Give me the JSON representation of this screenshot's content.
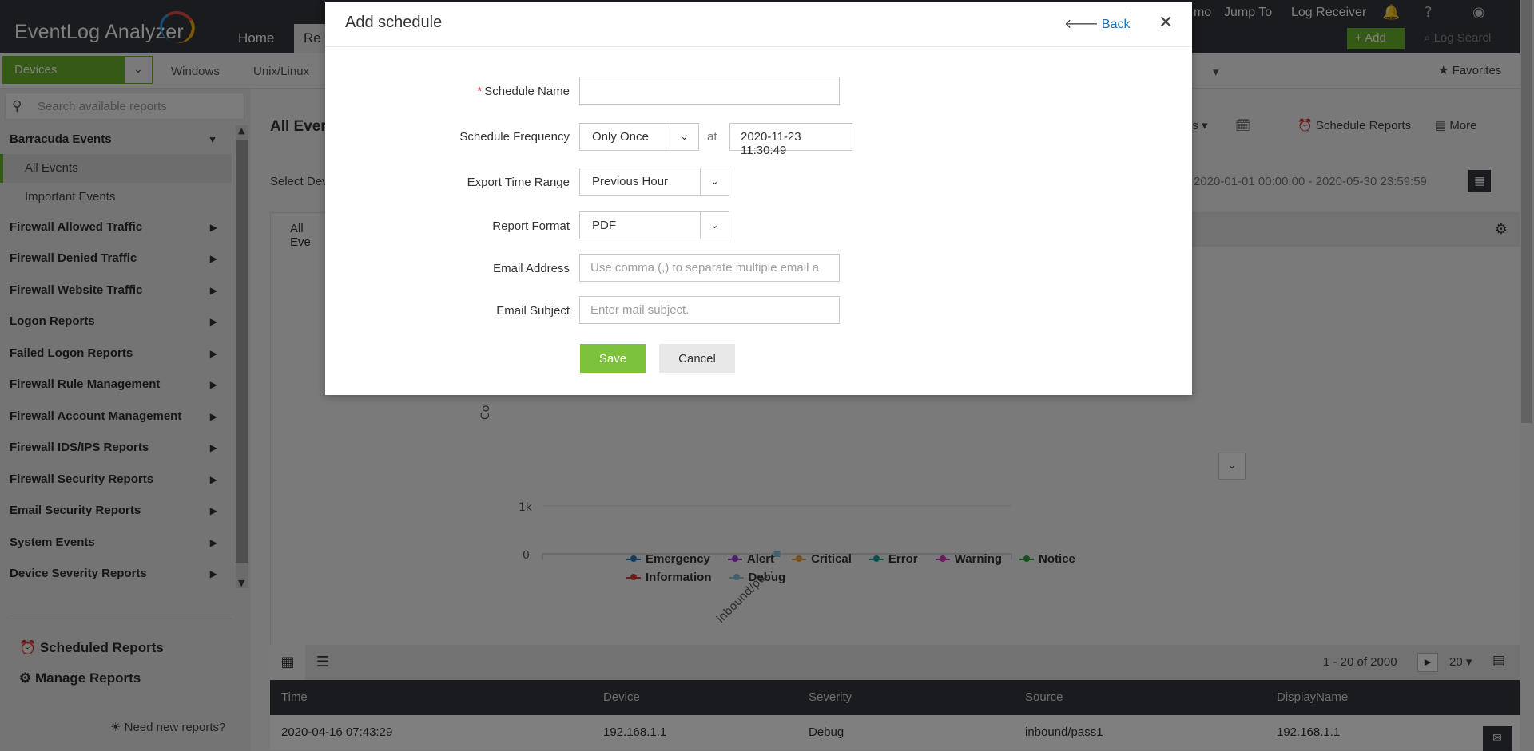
{
  "app": {
    "logo_text": "EventLog Analyzer",
    "main_tabs": [
      "Home",
      "Re"
    ],
    "top_links": [
      "mo",
      "Jump To",
      "Log Receiver"
    ],
    "add_label": "+ Add",
    "log_search_placeholder": "Log Searcl"
  },
  "subbar": {
    "devices_label": "Devices",
    "tabs": [
      "Windows",
      "Unix/Linux"
    ],
    "favorites_label": "Favorites"
  },
  "sidebar": {
    "search_placeholder": "Search available reports",
    "group_title": "Barracuda Events",
    "sub_items": [
      {
        "label": "All Events",
        "active": true
      },
      {
        "label": "Important Events",
        "active": false
      }
    ],
    "groups": [
      "Firewall Allowed Traffic",
      "Firewall Denied Traffic",
      "Firewall Website Traffic",
      "Logon Reports",
      "Failed Logon Reports",
      "Firewall Rule Management",
      "Firewall Account Management",
      "Firewall IDS/IPS Reports",
      "Firewall Security Reports",
      "Email Security Reports",
      "System Events",
      "Device Severity Reports"
    ],
    "bottom_links": [
      "Scheduled Reports",
      "Manage Reports"
    ],
    "need_new": "Need new reports?"
  },
  "main": {
    "page_title": "All Ever",
    "select_device": "Select Dev",
    "toolbar": {
      "as_label": "as",
      "schedule_label": "Schedule Reports",
      "more_label": "More"
    },
    "date_range": "2020-01-01 00:00:00 - 2020-05-30 23:59:59",
    "panel_tab": "All Eve"
  },
  "chart_data": {
    "type": "line",
    "categories": [
      "inbound/pa..."
    ],
    "ylabel": "Co",
    "y_ticks": [
      "1k",
      "0"
    ],
    "series": [
      {
        "name": "Emergency",
        "color": "#2b7bb9",
        "values": [
          0
        ]
      },
      {
        "name": "Alert",
        "color": "#9b3ed6",
        "values": [
          0
        ]
      },
      {
        "name": "Critical",
        "color": "#e8a33a",
        "values": [
          0
        ]
      },
      {
        "name": "Error",
        "color": "#17a398",
        "values": [
          0
        ]
      },
      {
        "name": "Warning",
        "color": "#d43ab4",
        "values": [
          0
        ]
      },
      {
        "name": "Notice",
        "color": "#2e9e3e",
        "values": [
          0
        ]
      },
      {
        "name": "Information",
        "color": "#d93a3a",
        "values": [
          0
        ]
      },
      {
        "name": "Debug",
        "color": "#8cc0e0",
        "values": [
          0
        ]
      }
    ]
  },
  "table": {
    "pager_text": "1 - 20 of 2000",
    "per_page": "20",
    "columns": [
      "Time",
      "Device",
      "Severity",
      "Source",
      "DisplayName"
    ],
    "rows": [
      [
        "2020-04-16 07:43:29",
        "192.168.1.1",
        "Debug",
        "inbound/pass1",
        "192.168.1.1"
      ]
    ]
  },
  "modal": {
    "title": "Add schedule",
    "back_label": "Back",
    "fields": {
      "schedule_name_label": "Schedule Name",
      "schedule_name_value": "",
      "frequency_label": "Schedule Frequency",
      "frequency_value": "Only Once",
      "at_label": "at",
      "datetime_value": "2020-11-23 11:30:49",
      "time_range_label": "Export Time Range",
      "time_range_value": "Previous Hour",
      "format_label": "Report Format",
      "format_value": "PDF",
      "email_label": "Email Address",
      "email_placeholder": "Use comma (,) to separate multiple email a",
      "subject_label": "Email Subject",
      "subject_placeholder": "Enter mail subject."
    },
    "save_label": "Save",
    "cancel_label": "Cancel"
  }
}
